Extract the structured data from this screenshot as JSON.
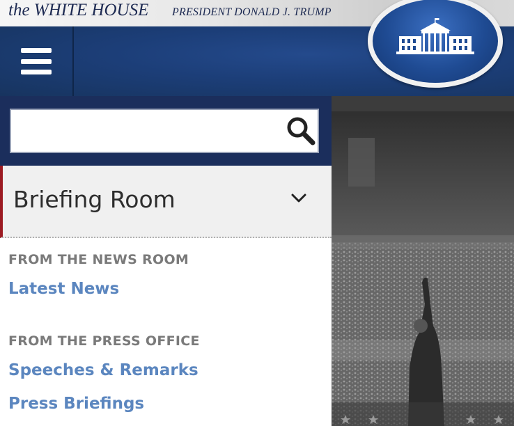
{
  "brand": {
    "title": "the WHITE HOUSE",
    "subtitle": "PRESIDENT DONALD J. TRUMP"
  },
  "search": {
    "value": "",
    "placeholder": ""
  },
  "section": {
    "title": "Briefing Room"
  },
  "menu": {
    "groups": [
      {
        "heading": "FROM THE NEWS ROOM",
        "links": [
          "Latest News"
        ]
      },
      {
        "heading": "FROM THE PRESS OFFICE",
        "links": [
          "Speeches & Remarks",
          "Press Briefings"
        ]
      }
    ]
  },
  "icons": {
    "menu": "hamburger-icon",
    "search": "search-icon",
    "expand": "chevron-down-icon",
    "seal": "white-house-seal"
  },
  "colors": {
    "navy": "#1b2e5c",
    "header_blue": "#1c3e78",
    "accent_red": "#9c1b22",
    "link_blue": "#5b86bf",
    "heading_gray": "#7a7a7a"
  }
}
